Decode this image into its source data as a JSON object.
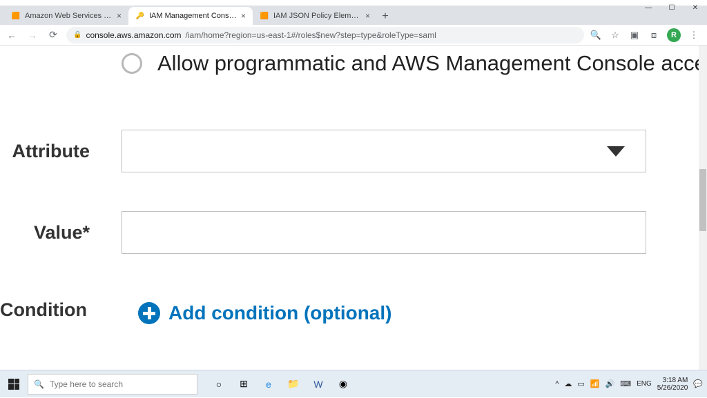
{
  "window": {
    "tabs": [
      {
        "title": "Amazon Web Services Sign-In",
        "active": false
      },
      {
        "title": "IAM Management Console",
        "active": true
      },
      {
        "title": "IAM JSON Policy Elements Refere",
        "active": false
      }
    ],
    "url_host": "console.aws.amazon.com",
    "url_path": "/iam/home?region=us-east-1#/roles$new?step=type&roleType=saml",
    "avatar_initial": "R"
  },
  "page": {
    "radio_option_label": "Allow programmatic and AWS Management Console acce",
    "attribute_label": "Attribute",
    "attribute_value": "",
    "value_label": "Value*",
    "value_value": "",
    "condition_label": "Condition",
    "add_condition_label": "Add condition (optional)"
  },
  "taskbar": {
    "search_placeholder": "Type here to search",
    "lang": "ENG",
    "time": "3:18 AM",
    "date": "5/26/2020"
  }
}
